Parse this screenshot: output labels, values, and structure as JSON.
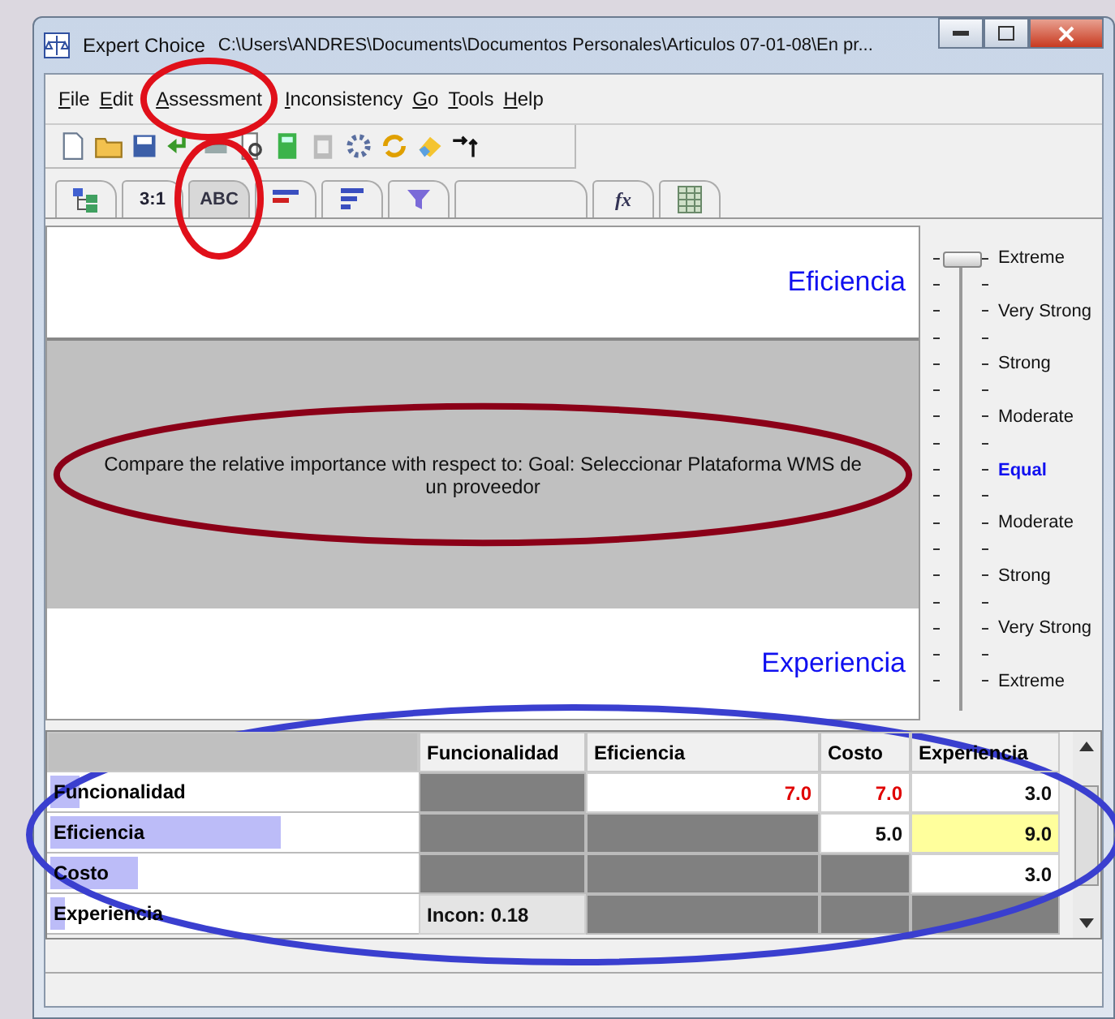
{
  "window": {
    "title": "Expert Choice",
    "path": "C:\\Users\\ANDRES\\Documents\\Documentos Personales\\Articulos 07-01-08\\En pr..."
  },
  "menu": [
    {
      "label": "File",
      "circled": false
    },
    {
      "label": "Edit",
      "circled": false
    },
    {
      "label": "Assessment",
      "circled": true
    },
    {
      "label": "Inconsistency",
      "circled": false
    },
    {
      "label": "Go",
      "circled": false
    },
    {
      "label": "Tools",
      "circled": false
    },
    {
      "label": "Help",
      "circled": false
    }
  ],
  "tabs": [
    {
      "kind": "tree",
      "selected": false,
      "circled": false
    },
    {
      "kind": "text",
      "label": "3:1",
      "selected": false,
      "circled": false
    },
    {
      "kind": "text",
      "label": "ABC",
      "selected": true,
      "circled": true
    },
    {
      "kind": "bars-red",
      "selected": false,
      "circled": false
    },
    {
      "kind": "bars-blue",
      "selected": false,
      "circled": false
    },
    {
      "kind": "funnel",
      "selected": false,
      "circled": false
    },
    {
      "kind": "blank",
      "selected": false,
      "circled": false
    },
    {
      "kind": "formula",
      "label": "fx",
      "selected": false,
      "circled": false
    },
    {
      "kind": "grid",
      "selected": false,
      "circled": false
    }
  ],
  "comparison": {
    "top": "Eficiencia",
    "question": "Compare the relative importance with respect to: Goal: Seleccionar Plataforma WMS de un proveedor",
    "question_circled": true,
    "bottom": "Experiencia"
  },
  "scale": {
    "level": 1,
    "labels": [
      {
        "label": "Extreme",
        "emphasized": false
      },
      {
        "label": "Very Strong",
        "emphasized": false
      },
      {
        "label": "Strong",
        "emphasized": false
      },
      {
        "label": "Moderate",
        "emphasized": false
      },
      {
        "label": "Equal",
        "emphasized": true
      },
      {
        "label": "Moderate",
        "emphasized": false
      },
      {
        "label": "Strong",
        "emphasized": false
      },
      {
        "label": "Very Strong",
        "emphasized": false
      },
      {
        "label": "Extreme",
        "emphasized": false
      }
    ]
  },
  "matrix": {
    "circled": true,
    "columns": [
      "Funcionalidad",
      "Eficiencia",
      "Costo",
      "Experiencia"
    ],
    "rows": [
      {
        "label": "Funcionalidad",
        "level": 0.08,
        "cells": [
          {
            "kind": "blocked"
          },
          {
            "kind": "value",
            "value": "7.0",
            "inverted": true,
            "selected": false
          },
          {
            "kind": "value",
            "value": "7.0",
            "inverted": true,
            "selected": false
          },
          {
            "kind": "value",
            "value": "3.0",
            "inverted": false,
            "selected": false
          }
        ]
      },
      {
        "label": "Eficiencia",
        "level": 0.63,
        "cells": [
          {
            "kind": "blocked"
          },
          {
            "kind": "blocked"
          },
          {
            "kind": "value",
            "value": "5.0",
            "inverted": false,
            "selected": false
          },
          {
            "kind": "value",
            "value": "9.0",
            "inverted": false,
            "selected": true
          }
        ]
      },
      {
        "label": "Costo",
        "level": 0.24,
        "cells": [
          {
            "kind": "blocked"
          },
          {
            "kind": "blocked"
          },
          {
            "kind": "blocked"
          },
          {
            "kind": "value",
            "value": "3.0",
            "inverted": false,
            "selected": false
          }
        ]
      },
      {
        "label": "Experiencia",
        "level": 0.04,
        "cells": [
          {
            "kind": "note",
            "value": "Incon: 0.18"
          },
          {
            "kind": "blocked"
          },
          {
            "kind": "blocked"
          },
          {
            "kind": "blocked"
          }
        ]
      }
    ]
  }
}
